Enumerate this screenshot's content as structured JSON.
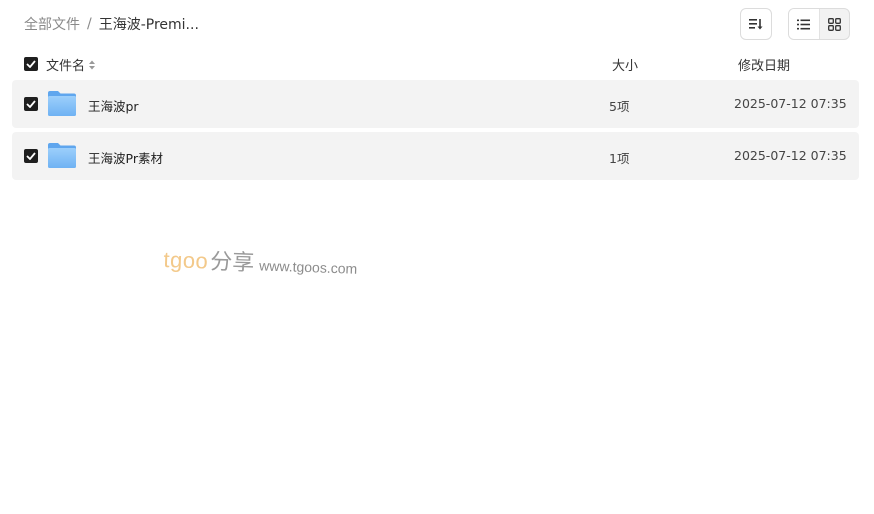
{
  "breadcrumb": {
    "root": "全部文件",
    "separator": "/",
    "current": "王海波-Premi..."
  },
  "toolbar": {
    "sort_icon": "sort-icon",
    "list_view_icon": "list-view-icon",
    "grid_view_icon": "grid-view-icon",
    "active_view": "list"
  },
  "table": {
    "headers": {
      "name": "文件名",
      "size": "大小",
      "date": "修改日期"
    },
    "rows": [
      {
        "name": "王海波pr",
        "size": "5项",
        "date": "2025-07-12 07:35",
        "checked": true,
        "icon": "folder-icon"
      },
      {
        "name": "王海波Pr素材",
        "size": "1项",
        "date": "2025-07-12 07:35",
        "checked": true,
        "icon": "folder-icon"
      }
    ]
  },
  "watermark": {
    "brand": "tgoo",
    "cn": "分享",
    "url": "www.tgoos.com"
  },
  "colors": {
    "row_bg": "#f3f3f3",
    "checkbox": "#1f1f1f",
    "folder": "#7cb9f5",
    "watermark_brand": "#f3c98a"
  }
}
